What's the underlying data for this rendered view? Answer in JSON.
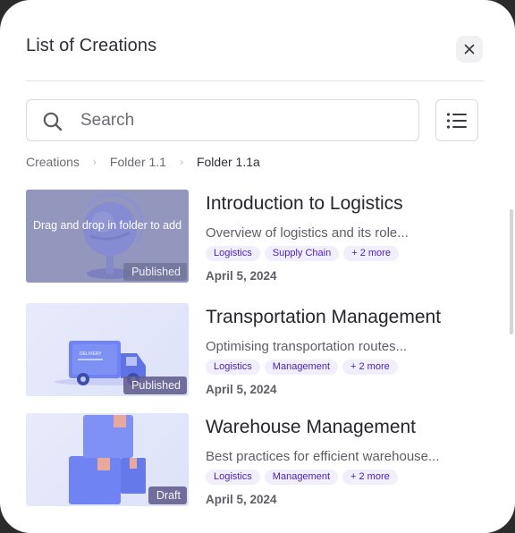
{
  "header": {
    "title": "List of Creations",
    "close_icon": "close-icon"
  },
  "search": {
    "placeholder": "Search",
    "value": "",
    "icon": "search-icon"
  },
  "view_toggle": {
    "icon": "list-view-icon"
  },
  "breadcrumb": [
    "Creations",
    "Folder 1.1",
    "Folder 1.1a"
  ],
  "drag_hint": "Drag and drop in folder to add",
  "items": [
    {
      "title": "Introduction to Logistics",
      "description": "Overview of logistics and its role...",
      "tags": [
        "Logistics",
        "Supply Chain",
        "+ 2 more"
      ],
      "date": "April 5, 2024",
      "status": "Published",
      "thumbnail": "globe-illustration"
    },
    {
      "title": "Transportation Management",
      "description": "Optimising transportation routes...",
      "tags": [
        "Logistics",
        "Management",
        "+ 2 more"
      ],
      "date": "April 5, 2024",
      "status": "Published",
      "thumbnail": "delivery-truck-illustration",
      "truck_text": "DELIVERY"
    },
    {
      "title": "Warehouse Management",
      "description": "Best practices for efficient warehouse...",
      "tags": [
        "Logistics",
        "Management",
        "+ 2 more"
      ],
      "date": "April 5, 2024",
      "status": "Draft",
      "thumbnail": "stacked-boxes-illustration"
    }
  ],
  "colors": {
    "accent": "#4e23b8",
    "tag_bg": "#f1effb",
    "status_bg": "#625c8c",
    "illustration": "#6f84f2"
  }
}
